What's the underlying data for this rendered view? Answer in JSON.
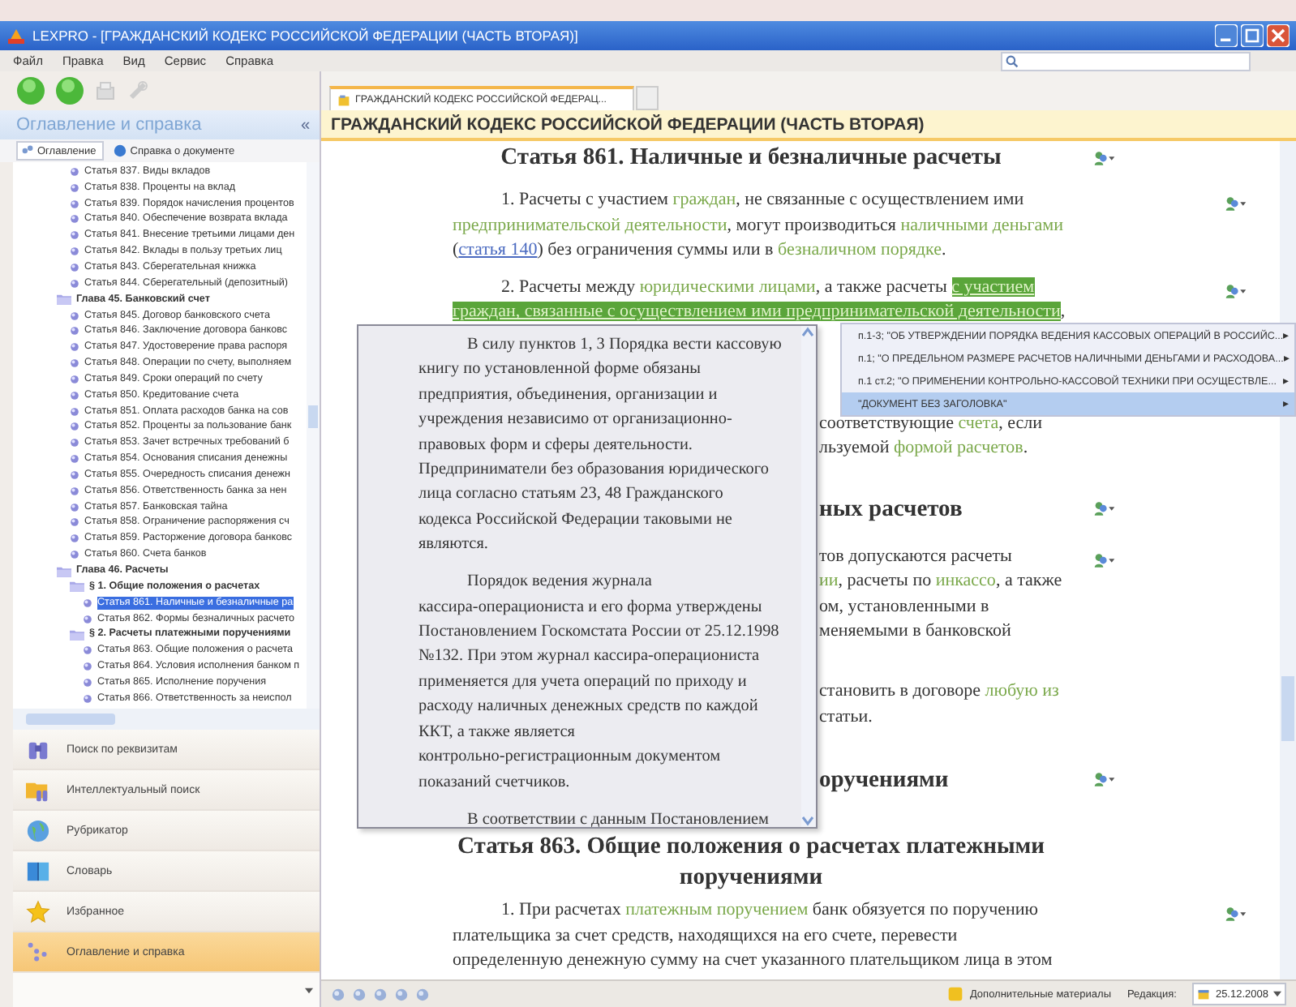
{
  "window": {
    "title": "LEXPRO - [ГРАЖДАНСКИЙ КОДЕКС РОССИЙСКОЙ ФЕДЕРАЦИИ (ЧАСТЬ ВТОРАЯ)]"
  },
  "menu": [
    "Файл",
    "Правка",
    "Вид",
    "Сервис",
    "Справка"
  ],
  "sidebar": {
    "title": "Оглавление и справка",
    "collapse": "«",
    "tabs": [
      {
        "label": "Оглавление",
        "selected": true
      },
      {
        "label": "Справка о документе",
        "selected": false
      }
    ],
    "tree": [
      {
        "kind": "article",
        "label": "Статья 837. Виды вкладов",
        "selected": false
      },
      {
        "kind": "article",
        "label": "Статья 838. Проценты на вклад",
        "selected": false
      },
      {
        "kind": "article",
        "label": "Статья 839. Порядок начисления процентов",
        "selected": false
      },
      {
        "kind": "article",
        "label": "Статья 840. Обеспечение возврата вклада",
        "selected": false
      },
      {
        "kind": "article",
        "label": "Статья 841. Внесение третьими лицами ден",
        "selected": false
      },
      {
        "kind": "article",
        "label": "Статья 842. Вклады в пользу третьих лиц",
        "selected": false
      },
      {
        "kind": "article",
        "label": "Статья 843. Сберегательная книжка",
        "selected": false
      },
      {
        "kind": "article",
        "label": "Статья 844. Сберегательный (депозитный)",
        "selected": false
      },
      {
        "kind": "chapter",
        "label": "Глава 45. Банковский счет",
        "selected": false,
        "children": [
          {
            "kind": "article",
            "label": "Статья 845. Договор банковского счета",
            "selected": false
          },
          {
            "kind": "article",
            "label": "Статья 846. Заключение договора банковс",
            "selected": false
          },
          {
            "kind": "article",
            "label": "Статья 847. Удостоверение права распоря",
            "selected": false
          },
          {
            "kind": "article",
            "label": "Статья 848. Операции по счету, выполняем",
            "selected": false
          },
          {
            "kind": "article",
            "label": "Статья 849. Сроки операций по счету",
            "selected": false
          },
          {
            "kind": "article",
            "label": "Статья 850. Кредитование счета",
            "selected": false
          },
          {
            "kind": "article",
            "label": "Статья 851. Оплата расходов банка на сов",
            "selected": false
          },
          {
            "kind": "article",
            "label": "Статья 852. Проценты за пользование банк",
            "selected": false
          },
          {
            "kind": "article",
            "label": "Статья 853. Зачет встречных требований б",
            "selected": false
          },
          {
            "kind": "article",
            "label": "Статья 854. Основания списания денежны",
            "selected": false
          },
          {
            "kind": "article",
            "label": "Статья 855. Очередность списания денежн",
            "selected": false
          },
          {
            "kind": "article",
            "label": "Статья 856. Ответственность банка за нен",
            "selected": false
          },
          {
            "kind": "article",
            "label": "Статья 857. Банковская тайна",
            "selected": false
          },
          {
            "kind": "article",
            "label": "Статья 858. Ограничение распоряжения сч",
            "selected": false
          },
          {
            "kind": "article",
            "label": "Статья 859. Расторжение договора банковс",
            "selected": false
          },
          {
            "kind": "article",
            "label": "Статья 860. Счета банков",
            "selected": false
          }
        ]
      },
      {
        "kind": "chapter",
        "label": "Глава 46. Расчеты",
        "selected": false,
        "children": [
          {
            "kind": "chapter",
            "label": "§ 1. Общие положения о расчетах",
            "selected": false,
            "children": [
              {
                "kind": "article",
                "label": "Статья 861. Наличные и безналичные ра",
                "selected": true
              },
              {
                "kind": "article",
                "label": "Статья 862. Формы безналичных расчето",
                "selected": false
              }
            ]
          },
          {
            "kind": "chapter",
            "label": "§ 2. Расчеты платежными поручениями",
            "selected": false,
            "children": [
              {
                "kind": "article",
                "label": "Статья 863. Общие положения о расчета",
                "selected": false
              },
              {
                "kind": "article",
                "label": "Статья 864. Условия исполнения банком п",
                "selected": false
              },
              {
                "kind": "article",
                "label": "Статья 865. Исполнение поручения",
                "selected": false
              },
              {
                "kind": "article",
                "label": "Статья 866. Ответственность за неиспол",
                "selected": false
              }
            ]
          }
        ]
      }
    ],
    "nav": [
      {
        "kind": "binoculars",
        "label": "Поиск по реквизитам",
        "selected": false
      },
      {
        "kind": "folder",
        "label": "Интеллектуальный поиск",
        "selected": false
      },
      {
        "kind": "globe",
        "label": "Рубрикатор",
        "selected": false
      },
      {
        "kind": "book",
        "label": "Словарь",
        "selected": false
      },
      {
        "kind": "star",
        "label": "Избранное",
        "selected": false
      },
      {
        "kind": "tree",
        "label": "Оглавление и справка",
        "selected": true
      }
    ]
  },
  "document": {
    "tab": "ГРАЖДАНСКИЙ КОДЕКС РОССИЙСКОЙ ФЕДЕРАЦ...",
    "header": "ГРАЖДАНСКИЙ КОДЕКС РОССИЙСКОЙ ФЕДЕРАЦИИ (ЧАСТЬ ВТОРАЯ)",
    "blocks": [
      {
        "kind": "title",
        "menu_icon": true,
        "segments": [
          {
            "kind": "plain",
            "text": "Статья 861. Наличные и безналичные расчеты"
          }
        ]
      },
      {
        "kind": "para",
        "menu_icon": true,
        "segments": [
          {
            "kind": "plain",
            "text": "1. Расчеты с участием "
          },
          {
            "kind": "term",
            "text": "граждан"
          },
          {
            "kind": "plain",
            "text": ", не связанные с осуществлением ими\n"
          },
          {
            "kind": "term",
            "text": "предпринимательской деятельности"
          },
          {
            "kind": "plain",
            "text": ", могут производиться "
          },
          {
            "kind": "term",
            "text": "наличными деньгами"
          },
          {
            "kind": "plain",
            "text": "\n("
          },
          {
            "kind": "ref",
            "text": "статья 140"
          },
          {
            "kind": "plain",
            "text": ") без ограничения суммы или в "
          },
          {
            "kind": "term",
            "text": "безналичном порядке"
          },
          {
            "kind": "plain",
            "text": "."
          }
        ]
      },
      {
        "kind": "para",
        "menu_icon": true,
        "segments": [
          {
            "kind": "plain",
            "text": "2. Расчеты между "
          },
          {
            "kind": "term",
            "text": "юридическими лицами"
          },
          {
            "kind": "plain",
            "text": ", а также расчеты "
          },
          {
            "kind": "highlight",
            "text": "с участием"
          },
          {
            "kind": "break"
          },
          {
            "kind": "highlight",
            "text": "граждан, связанные с осуществлением ими предпринимательской деятельности"
          },
          {
            "kind": "plain",
            "text": ","
          }
        ]
      },
      {
        "kind": "fragment",
        "menu_icon": false,
        "segments": [
          {
            "kind": "plain",
            "text": "соответствующие "
          },
          {
            "kind": "term",
            "text": "счета"
          },
          {
            "kind": "plain",
            "text": ", если\nльзуемой "
          },
          {
            "kind": "term",
            "text": "формой расчетов"
          },
          {
            "kind": "plain",
            "text": "."
          }
        ]
      },
      {
        "kind": "fragment_title",
        "menu_icon": true,
        "segments": [
          {
            "kind": "plain",
            "text": "ных расчетов"
          }
        ]
      },
      {
        "kind": "fragment",
        "menu_icon": true,
        "segments": [
          {
            "kind": "plain",
            "text": "тов допускаются расчеты\n"
          },
          {
            "kind": "term",
            "text": "ии"
          },
          {
            "kind": "plain",
            "text": ", расчеты по "
          },
          {
            "kind": "term",
            "text": "инкассо"
          },
          {
            "kind": "plain",
            "text": ", а также\nом, установленными в\nменяемыми в банковской"
          }
        ]
      },
      {
        "kind": "fragment",
        "menu_icon": false,
        "segments": [
          {
            "kind": "plain",
            "text": "становить в договоре "
          },
          {
            "kind": "term",
            "text": "любую из"
          },
          {
            "kind": "plain",
            "text": "\nстатьи."
          }
        ]
      },
      {
        "kind": "fragment_title",
        "menu_icon": true,
        "segments": [
          {
            "kind": "plain",
            "text": "оручениями"
          }
        ]
      },
      {
        "kind": "title",
        "menu_icon": false,
        "segments": [
          {
            "kind": "plain",
            "text": "Статья 863. Общие положения о расчетах платежными\nпоручениями"
          }
        ]
      },
      {
        "kind": "para",
        "menu_icon": true,
        "segments": [
          {
            "kind": "plain",
            "text": "1. При расчетах "
          },
          {
            "kind": "term",
            "text": "платежным поручением"
          },
          {
            "kind": "plain",
            "text": " банк обязуется по поручению\nплательщика за счет средств, находящихся на его счете, перевести\nопределенную денежную сумму на счет указанного плательщиком лица в этом"
          }
        ]
      }
    ]
  },
  "popup": {
    "paragraphs": [
      "В силу пунктов 1, 3 Порядка вести кассовую\nкнигу по установленной форме обязаны\nпредприятия, объединения, организации и\nучреждения независимо от организационно-\nправовых форм и сферы деятельности.\nПредприниматели без образования юридического\nлица согласно статьям 23, 48 Гражданского\nкодекса Российской Федерации таковыми не\nявляются.",
      "Порядок ведения журнала\nкассира-операциониста и его форма утверждены\nПостановлением Госкомстата России от 25.12.1998\n№132. При этом журнал кассира-операциониста\nприменяется для учета операций по приходу и\nрасходу наличных денежных средств по каждой\nККТ, а также является\nконтрольно-регистрационным документом\nпоказаний счетчиков.",
      "В соответствии с данным Постановлением"
    ]
  },
  "context_menu": [
    {
      "label": "п.1-3; \"ОБ УТВЕРЖДЕНИИ ПОРЯДКА ВЕДЕНИЯ КАССОВЫХ ОПЕРАЦИЙ В РОССИЙС...",
      "arrow": "▸",
      "selected": false
    },
    {
      "label": "п.1; \"О ПРЕДЕЛЬНОМ РАЗМЕРЕ РАСЧЕТОВ НАЛИЧНЫМИ ДЕНЬГАМИ И РАСХОДОВА...",
      "arrow": "▸",
      "selected": false
    },
    {
      "label": "п.1 ст.2; \"О ПРИМЕНЕНИИ КОНТРОЛЬНО-КАССОВОЙ ТЕХНИКИ ПРИ ОСУЩЕСТВЛЕ...",
      "arrow": "▸",
      "selected": false
    },
    {
      "label": "\"ДОКУМЕНТ БЕЗ ЗАГОЛОВКА\"",
      "arrow": "▸",
      "selected": true
    }
  ],
  "status_bar": {
    "materials": "Дополнительные материалы",
    "edition_label": "Редакция:",
    "edition": "25.12.2008"
  }
}
